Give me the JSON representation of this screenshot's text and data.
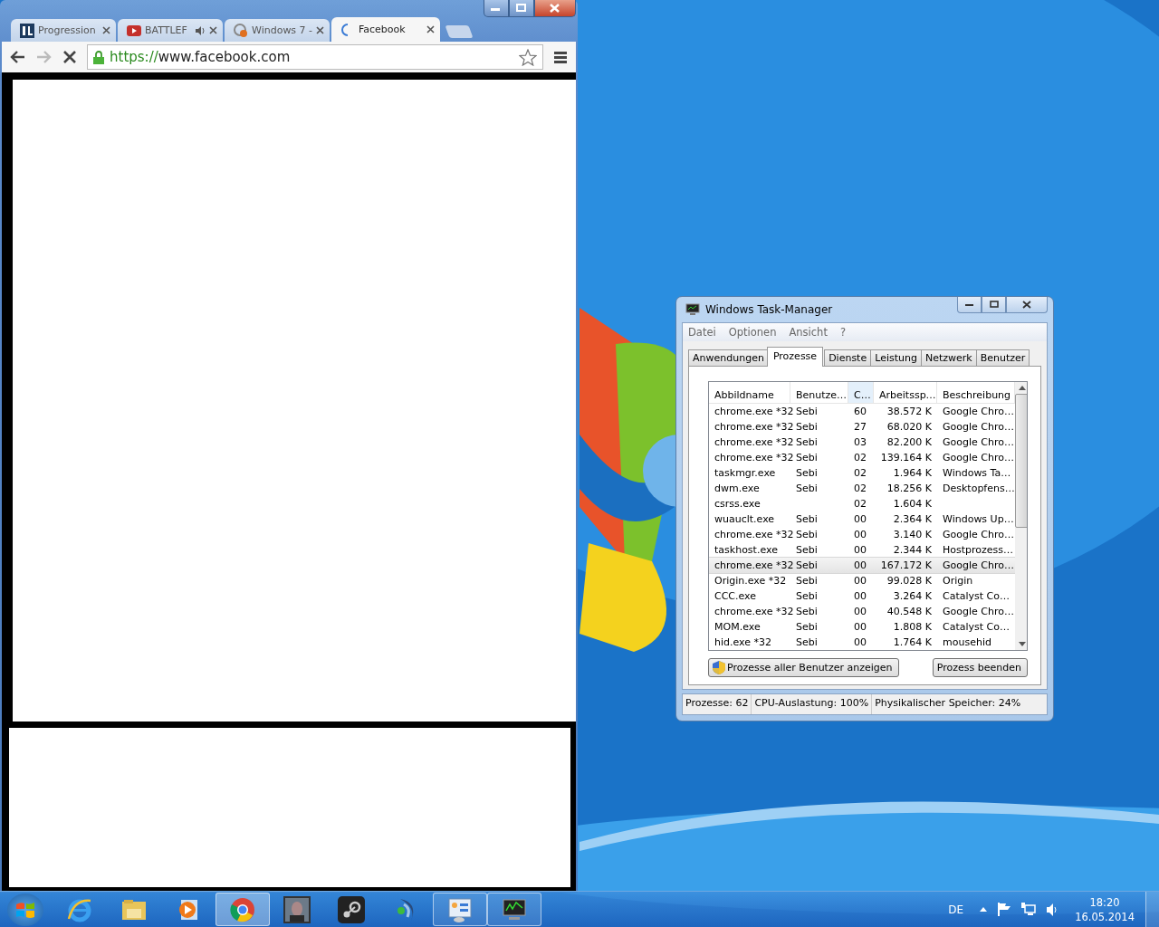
{
  "browser": {
    "tabs": [
      {
        "kind": "bl",
        "title": "Progression",
        "audio": false,
        "selected": false
      },
      {
        "kind": "video",
        "title": "BATTLEF",
        "audio": true,
        "selected": false
      },
      {
        "kind": "cb",
        "title": "Windows 7 -",
        "audio": false,
        "selected": false
      },
      {
        "kind": "loading",
        "title": "Facebook",
        "audio": false,
        "selected": true
      }
    ],
    "url_scheme": "https://",
    "url_rest": "www.facebook.com",
    "loading": true,
    "bookmarked": false
  },
  "task_manager": {
    "title": "Windows Task-Manager",
    "menu": [
      "Datei",
      "Optionen",
      "Ansicht",
      "?"
    ],
    "tabs": [
      {
        "label": "Anwendungen",
        "selected": false
      },
      {
        "label": "Prozesse",
        "selected": true
      },
      {
        "label": "Dienste",
        "selected": false
      },
      {
        "label": "Leistung",
        "selected": false
      },
      {
        "label": "Netzwerk",
        "selected": false
      },
      {
        "label": "Benutzer",
        "selected": false
      }
    ],
    "columns": [
      "Abbildname",
      "Benutze…",
      "C…",
      "Arbeitssp…",
      "Beschreibung"
    ],
    "rows": [
      {
        "cells": [
          "chrome.exe *32",
          "Sebi",
          "60",
          "38.572 K",
          "Google Chro…"
        ],
        "selected": false
      },
      {
        "cells": [
          "chrome.exe *32",
          "Sebi",
          "27",
          "68.020 K",
          "Google Chro…"
        ],
        "selected": false
      },
      {
        "cells": [
          "chrome.exe *32",
          "Sebi",
          "03",
          "82.200 K",
          "Google Chro…"
        ],
        "selected": false
      },
      {
        "cells": [
          "chrome.exe *32",
          "Sebi",
          "02",
          "139.164 K",
          "Google Chro…"
        ],
        "selected": false
      },
      {
        "cells": [
          "taskmgr.exe",
          "Sebi",
          "02",
          "1.964 K",
          "Windows Ta…"
        ],
        "selected": false
      },
      {
        "cells": [
          "dwm.exe",
          "Sebi",
          "02",
          "18.256 K",
          "Desktopfens…"
        ],
        "selected": false
      },
      {
        "cells": [
          "csrss.exe",
          "",
          "02",
          "1.604 K",
          ""
        ],
        "selected": false
      },
      {
        "cells": [
          "wuauclt.exe",
          "Sebi",
          "00",
          "2.364 K",
          "Windows Up…"
        ],
        "selected": false
      },
      {
        "cells": [
          "chrome.exe *32",
          "Sebi",
          "00",
          "3.140 K",
          "Google Chro…"
        ],
        "selected": false
      },
      {
        "cells": [
          "taskhost.exe",
          "Sebi",
          "00",
          "2.344 K",
          "Hostprozess…"
        ],
        "selected": false
      },
      {
        "cells": [
          "chrome.exe *32",
          "Sebi",
          "00",
          "167.172 K",
          "Google Chro…"
        ],
        "selected": true
      },
      {
        "cells": [
          "Origin.exe *32",
          "Sebi",
          "00",
          "99.028 K",
          "Origin"
        ],
        "selected": false
      },
      {
        "cells": [
          "CCC.exe",
          "Sebi",
          "00",
          "3.264 K",
          "Catalyst Co…"
        ],
        "selected": false
      },
      {
        "cells": [
          "chrome.exe *32",
          "Sebi",
          "00",
          "40.548 K",
          "Google Chro…"
        ],
        "selected": false
      },
      {
        "cells": [
          "MOM.exe",
          "Sebi",
          "00",
          "1.808 K",
          "Catalyst Co…"
        ],
        "selected": false
      },
      {
        "cells": [
          "hid.exe *32",
          "Sebi",
          "00",
          "1.764 K",
          "mousehid"
        ],
        "selected": false
      }
    ],
    "show_all_button": "Prozesse aller Benutzer anzeigen",
    "end_button": "Prozess beenden",
    "status": [
      "Prozesse: 62",
      "CPU-Auslastung: 100%",
      "Physikalischer Speicher: 24%"
    ]
  },
  "taskbar": {
    "items": [
      {
        "kind": "ie",
        "running": false,
        "selected": false
      },
      {
        "kind": "folder",
        "running": false,
        "selected": false
      },
      {
        "kind": "media",
        "running": false,
        "selected": false
      },
      {
        "kind": "chrome",
        "running": true,
        "selected": true
      },
      {
        "kind": "game",
        "running": false,
        "selected": false
      },
      {
        "kind": "steam",
        "running": false,
        "selected": false
      },
      {
        "kind": "voice",
        "running": false,
        "selected": false
      },
      {
        "kind": "panel",
        "running": true,
        "selected": false
      },
      {
        "kind": "monitor",
        "running": true,
        "selected": false
      }
    ],
    "language": "DE",
    "time": "18:20",
    "date": "16.05.2014"
  }
}
